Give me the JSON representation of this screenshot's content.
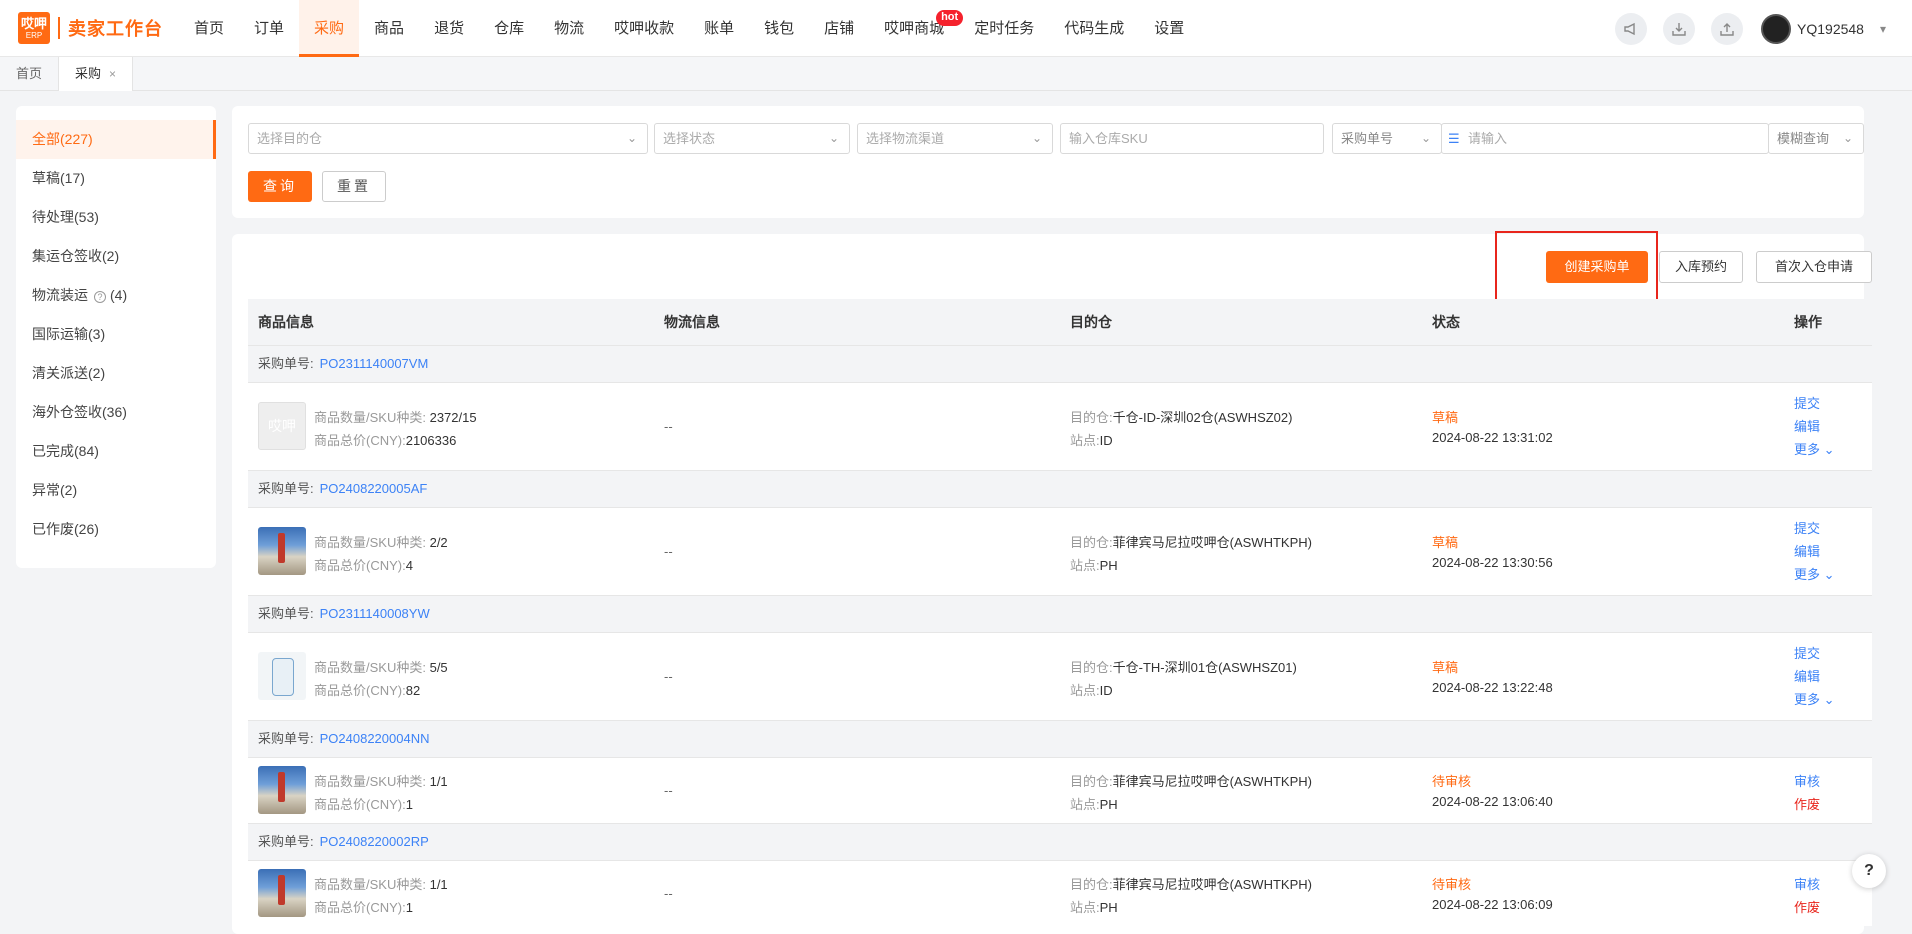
{
  "brand": {
    "logo_top": "哎呷",
    "logo_bottom": "ERP",
    "title": "卖家工作台"
  },
  "nav": [
    {
      "label": "首页"
    },
    {
      "label": "订单"
    },
    {
      "label": "采购",
      "active": true
    },
    {
      "label": "商品"
    },
    {
      "label": "退货"
    },
    {
      "label": "仓库"
    },
    {
      "label": "物流"
    },
    {
      "label": "哎呷收款"
    },
    {
      "label": "账单"
    },
    {
      "label": "钱包"
    },
    {
      "label": "店铺"
    },
    {
      "label": "哎呷商城",
      "badge": "hot"
    },
    {
      "label": "定时任务"
    },
    {
      "label": "代码生成"
    },
    {
      "label": "设置"
    }
  ],
  "user": {
    "name": "YQ192548"
  },
  "tabs": [
    {
      "label": "首页"
    },
    {
      "label": "采购",
      "close": "×"
    }
  ],
  "sidebar": {
    "items": [
      {
        "label": "全部(227)"
      },
      {
        "label": "草稿(17)"
      },
      {
        "label": "待处理(53)"
      },
      {
        "label": "集运仓签收(2)"
      },
      {
        "label": "物流装运",
        "count": "(4)"
      },
      {
        "label": "国际运输(3)"
      },
      {
        "label": "清关派送(2)"
      },
      {
        "label": "海外仓签收(36)"
      },
      {
        "label": "已完成(84)"
      },
      {
        "label": "异常(2)"
      },
      {
        "label": "已作废(26)"
      }
    ]
  },
  "filter": {
    "warehouse_placeholder": "选择目的仓",
    "status_placeholder": "选择状态",
    "logistics_placeholder": "选择物流渠道",
    "sku_placeholder": "输入仓库SKU",
    "field_select": "采购单号",
    "keyword_placeholder": "请输入",
    "match_select": "模糊查询",
    "query_label": "查询",
    "reset_label": "重置"
  },
  "actions": {
    "create": "创建采购单",
    "reserve": "入库预约",
    "first_apply": "首次入仓申请"
  },
  "table": {
    "headers": {
      "product": "商品信息",
      "logistics": "物流信息",
      "warehouse": "目的仓",
      "status": "状态",
      "ops": "操作"
    },
    "labels": {
      "po": "采购单号:",
      "qty": "商品数量/SKU种类:",
      "total": "商品总价(CNY):",
      "wh": "目的仓:",
      "site": "站点:",
      "empty": "--"
    },
    "rows": [
      {
        "po": "PO2311140007VM",
        "qty": "2372/15",
        "total": "2106336",
        "wh": "千仓-ID-深圳02仓(ASWHSZ02)",
        "site": "ID",
        "status": "草稿",
        "time": "2024-08-22 13:31:02",
        "ops": [
          "提交",
          "编辑",
          "更多"
        ]
      },
      {
        "po": "PO2408220005AF",
        "qty": "2/2",
        "total": "4",
        "wh": "菲律宾马尼拉哎呷仓(ASWHTKPH)",
        "site": "PH",
        "status": "草稿",
        "time": "2024-08-22 13:30:56",
        "ops": [
          "提交",
          "编辑",
          "更多"
        ]
      },
      {
        "po": "PO2311140008YW",
        "qty": "5/5",
        "total": "82",
        "wh": "千仓-TH-深圳01仓(ASWHSZ01)",
        "site": "ID",
        "status": "草稿",
        "time": "2024-08-22 13:22:48",
        "ops": [
          "提交",
          "编辑",
          "更多"
        ]
      },
      {
        "po": "PO2408220004NN",
        "qty": "1/1",
        "total": "1",
        "wh": "菲律宾马尼拉哎呷仓(ASWHTKPH)",
        "site": "PH",
        "status": "待审核",
        "time": "2024-08-22 13:06:40",
        "ops": [
          "审核",
          "作废"
        ]
      },
      {
        "po": "PO2408220002RP",
        "qty": "1/1",
        "total": "1",
        "wh": "菲律宾马尼拉哎呷仓(ASWHTKPH)",
        "site": "PH",
        "status": "待审核",
        "time": "2024-08-22 13:06:09",
        "ops": [
          "审核",
          "作废"
        ]
      }
    ]
  },
  "help": "?"
}
